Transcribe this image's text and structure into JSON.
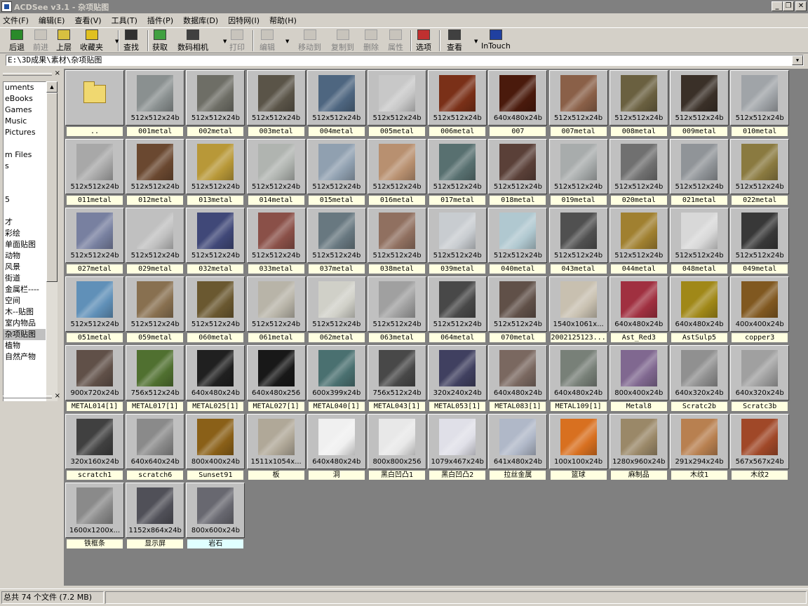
{
  "window": {
    "title": "ACDSee v3.1 - 杂项贴图",
    "min": "_",
    "restore": "❐",
    "close": "✕"
  },
  "menu": [
    "文件(F)",
    "编辑(E)",
    "查看(V)",
    "工具(T)",
    "插件(P)",
    "数据库(D)",
    "因特网(I)",
    "帮助(H)"
  ],
  "toolbar": [
    {
      "label": "后退",
      "icon": "back-arrow-icon",
      "enabled": true,
      "color": "#2a8a2a"
    },
    {
      "label": "前进",
      "icon": "forward-arrow-icon",
      "enabled": false,
      "color": "#909090"
    },
    {
      "label": "上层",
      "icon": "up-folder-icon",
      "enabled": true,
      "color": "#d8c040"
    },
    {
      "label": "收藏夹",
      "icon": "favorites-icon",
      "enabled": true,
      "color": "#e0c020"
    },
    {
      "label": "查找",
      "icon": "binoculars-icon",
      "enabled": true,
      "color": "#303030"
    },
    {
      "label": "获取",
      "icon": "acquire-icon",
      "enabled": true,
      "color": "#40a040"
    },
    {
      "label": "数码相机",
      "icon": "camera-icon",
      "enabled": true,
      "color": "#404040"
    },
    {
      "label": "打印",
      "icon": "printer-icon",
      "enabled": false,
      "color": "#909090"
    },
    {
      "label": "编辑",
      "icon": "edit-icon",
      "enabled": false,
      "color": "#909090"
    },
    {
      "label": "移动到",
      "icon": "move-icon",
      "enabled": false,
      "color": "#909090"
    },
    {
      "label": "复制到",
      "icon": "copy-icon",
      "enabled": false,
      "color": "#909090"
    },
    {
      "label": "删除",
      "icon": "delete-icon",
      "enabled": false,
      "color": "#909090"
    },
    {
      "label": "属性",
      "icon": "properties-icon",
      "enabled": false,
      "color": "#909090"
    },
    {
      "label": "选项",
      "icon": "options-icon",
      "enabled": true,
      "color": "#c03030"
    },
    {
      "label": "查看",
      "icon": "view-icon",
      "enabled": true,
      "color": "#404040"
    },
    {
      "label": "InTouch",
      "icon": "intouch-icon",
      "enabled": true,
      "color": "#2040a0"
    }
  ],
  "path": "E:\\3D成果\\素材\\杂项贴图",
  "tree": [
    "uments",
    "eBooks",
    "Games",
    "Music",
    "Pictures",
    "",
    "m Files",
    "s",
    "",
    "",
    "5",
    "",
    "才",
    "彩绘",
    "单面贴图",
    "动物",
    "风景",
    "街道",
    "金属栏----",
    "空间",
    "木--贴图",
    "室内物品",
    "杂项贴图",
    "植物",
    "自然产物"
  ],
  "tree_selected": "杂项贴图",
  "status": {
    "summary": "总共 74 个文件 (7.2 MB)"
  },
  "files": [
    {
      "name": "..",
      "dims": "",
      "folder": true
    },
    {
      "name": "001metal",
      "dims": "512x512x24b",
      "color": "#8a9090"
    },
    {
      "name": "002metal",
      "dims": "512x512x24b",
      "color": "#6e6e66"
    },
    {
      "name": "003metal",
      "dims": "512x512x24b",
      "color": "#5a5448"
    },
    {
      "name": "004metal",
      "dims": "512x512x24b",
      "color": "#4e6680"
    },
    {
      "name": "005metal",
      "dims": "512x512x24b",
      "color": "#c8c8c8"
    },
    {
      "name": "006metal",
      "dims": "512x512x24b",
      "color": "#7a3018"
    },
    {
      "name": "007",
      "dims": "640x480x24b",
      "color": "#4a1a0c"
    },
    {
      "name": "007metal",
      "dims": "512x512x24b",
      "color": "#8a6048"
    },
    {
      "name": "008metal",
      "dims": "512x512x24b",
      "color": "#6a6040"
    },
    {
      "name": "009metal",
      "dims": "512x512x24b",
      "color": "#3a3028"
    },
    {
      "name": "010metal",
      "dims": "512x512x24b",
      "color": "#a0a4a8"
    },
    {
      "name": "011metal",
      "dims": "512x512x24b",
      "color": "#a8a8a8"
    },
    {
      "name": "012metal",
      "dims": "512x512x24b",
      "color": "#6a4830"
    },
    {
      "name": "013metal",
      "dims": "512x512x24b",
      "color": "#b89838"
    },
    {
      "name": "014metal",
      "dims": "512x512x24b",
      "color": "#b0b4b0"
    },
    {
      "name": "015metal",
      "dims": "512x512x24b",
      "color": "#90a0b0"
    },
    {
      "name": "016metal",
      "dims": "512x512x24b",
      "color": "#b89070"
    },
    {
      "name": "017metal",
      "dims": "512x512x24b",
      "color": "#587070"
    },
    {
      "name": "018metal",
      "dims": "512x512x24b",
      "color": "#5a4038"
    },
    {
      "name": "019metal",
      "dims": "512x512x24b",
      "color": "#a8acac"
    },
    {
      "name": "020metal",
      "dims": "512x512x24b",
      "color": "#707070"
    },
    {
      "name": "021metal",
      "dims": "512x512x24b",
      "color": "#909498"
    },
    {
      "name": "022metal",
      "dims": "512x512x24b",
      "color": "#8a7a40"
    },
    {
      "name": "027metal",
      "dims": "512x512x24b",
      "color": "#7880a0"
    },
    {
      "name": "029metal",
      "dims": "512x512x24b",
      "color": "#c0c0c0"
    },
    {
      "name": "032metal",
      "dims": "512x512x24b",
      "color": "#404878"
    },
    {
      "name": "033metal",
      "dims": "512x512x24b",
      "color": "#8a5048"
    },
    {
      "name": "037metal",
      "dims": "512x512x24b",
      "color": "#687880"
    },
    {
      "name": "038metal",
      "dims": "512x512x24b",
      "color": "#907060"
    },
    {
      "name": "039metal",
      "dims": "512x512x24b",
      "color": "#c8ccd0"
    },
    {
      "name": "040metal",
      "dims": "512x512x24b",
      "color": "#b0c8d0"
    },
    {
      "name": "043metal",
      "dims": "512x512x24b",
      "color": "#505050"
    },
    {
      "name": "044metal",
      "dims": "512x512x24b",
      "color": "#a08030"
    },
    {
      "name": "048metal",
      "dims": "512x512x24b",
      "color": "#d8d8d8"
    },
    {
      "name": "049metal",
      "dims": "512x512x24b",
      "color": "#383838"
    },
    {
      "name": "051metal",
      "dims": "512x512x24b",
      "color": "#6090b8"
    },
    {
      "name": "059metal",
      "dims": "512x512x24b",
      "color": "#887050"
    },
    {
      "name": "060metal",
      "dims": "512x512x24b",
      "color": "#6a5830"
    },
    {
      "name": "061metal",
      "dims": "512x512x24b",
      "color": "#b8b4a8"
    },
    {
      "name": "062metal",
      "dims": "512x512x24b",
      "color": "#d0d0c8"
    },
    {
      "name": "063metal",
      "dims": "512x512x24b",
      "color": "#a0a0a0"
    },
    {
      "name": "064metal",
      "dims": "512x512x24b",
      "color": "#484848"
    },
    {
      "name": "070metal",
      "dims": "512x512x24b",
      "color": "#605048"
    },
    {
      "name": "2002125123...",
      "dims": "1540x1061x...",
      "color": "#c8c0b0"
    },
    {
      "name": "Ast_Red3",
      "dims": "640x480x24b",
      "color": "#a03040"
    },
    {
      "name": "AstSulp5",
      "dims": "640x480x24b",
      "color": "#a08818"
    },
    {
      "name": "copper3",
      "dims": "400x400x24b",
      "color": "#805820"
    },
    {
      "name": "METAL014[1]",
      "dims": "900x720x24b",
      "color": "#605048"
    },
    {
      "name": "METAL017[1]",
      "dims": "756x512x24b",
      "color": "#507030"
    },
    {
      "name": "METAL025[1]",
      "dims": "640x480x24b",
      "color": "#202020"
    },
    {
      "name": "METAL027[1]",
      "dims": "640x480x256",
      "color": "#181818"
    },
    {
      "name": "METAL040[1]",
      "dims": "600x399x24b",
      "color": "#4a7070"
    },
    {
      "name": "METAL043[1]",
      "dims": "756x512x24b",
      "color": "#484848"
    },
    {
      "name": "METAL053[1]",
      "dims": "320x240x24b",
      "color": "#404060"
    },
    {
      "name": "METAL083[1]",
      "dims": "640x480x24b",
      "color": "#7a6860"
    },
    {
      "name": "METAL109[1]",
      "dims": "640x480x24b",
      "color": "#788078"
    },
    {
      "name": "Metal8",
      "dims": "800x400x24b",
      "color": "#806890"
    },
    {
      "name": "Scratc2b",
      "dims": "640x320x24b",
      "color": "#909090"
    },
    {
      "name": "Scratc3b",
      "dims": "640x320x24b",
      "color": "#a0a0a0"
    },
    {
      "name": "scratch1",
      "dims": "320x160x24b",
      "color": "#404040"
    },
    {
      "name": "scratch6",
      "dims": "640x640x24b",
      "color": "#8a8a8a"
    },
    {
      "name": "Sunset91",
      "dims": "800x400x24b",
      "color": "#8a6018"
    },
    {
      "name": "板",
      "dims": "1511x1054x...",
      "color": "#b0a898"
    },
    {
      "name": "洞",
      "dims": "640x480x24b",
      "color": "#f0f0f0"
    },
    {
      "name": "黑白凹凸1",
      "dims": "800x800x256",
      "color": "#e8e8e8"
    },
    {
      "name": "黑白凹凸2",
      "dims": "1079x467x24b",
      "color": "#e0e0e8"
    },
    {
      "name": "拉丝金属",
      "dims": "641x480x24b",
      "color": "#b0b8c8"
    },
    {
      "name": "篮球",
      "dims": "100x100x24b",
      "color": "#d87020"
    },
    {
      "name": "麻制品",
      "dims": "1280x960x24b",
      "color": "#9a8868"
    },
    {
      "name": "木纹1",
      "dims": "291x294x24b",
      "color": "#b88050"
    },
    {
      "name": "木纹2",
      "dims": "567x567x24b",
      "color": "#a04828"
    },
    {
      "name": "铁框条",
      "dims": "1600x1200x...",
      "color": "#8a8a8a"
    },
    {
      "name": "显示屏",
      "dims": "1152x864x24b",
      "color": "#505058"
    },
    {
      "name": "岩石",
      "dims": "800x600x24b",
      "color": "#686870",
      "selected": true
    }
  ]
}
